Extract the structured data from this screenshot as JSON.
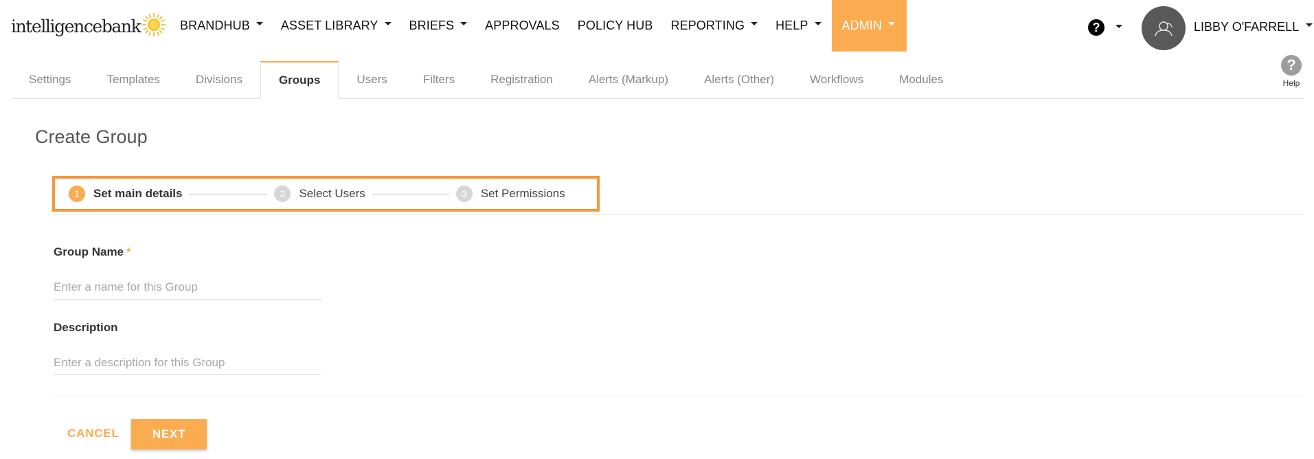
{
  "brand": {
    "logo_text": "intelligencebank",
    "accent_color": "#fbab50",
    "highlight_border_color": "#f6973a"
  },
  "topnav": {
    "items": [
      {
        "label": "BRANDHUB",
        "dropdown": true,
        "active": false
      },
      {
        "label": "ASSET LIBRARY",
        "dropdown": true,
        "active": false
      },
      {
        "label": "BRIEFS",
        "dropdown": true,
        "active": false
      },
      {
        "label": "APPROVALS",
        "dropdown": false,
        "active": false
      },
      {
        "label": "POLICY HUB",
        "dropdown": false,
        "active": false
      },
      {
        "label": "REPORTING",
        "dropdown": true,
        "active": false
      },
      {
        "label": "HELP",
        "dropdown": true,
        "active": false
      },
      {
        "label": "ADMIN",
        "dropdown": true,
        "active": true
      }
    ],
    "help_icon_glyph": "?",
    "user_name": "LIBBY O'FARRELL"
  },
  "subtabs": {
    "items": [
      {
        "label": "Settings",
        "active": false
      },
      {
        "label": "Templates",
        "active": false
      },
      {
        "label": "Divisions",
        "active": false
      },
      {
        "label": "Groups",
        "active": true
      },
      {
        "label": "Users",
        "active": false
      },
      {
        "label": "Filters",
        "active": false
      },
      {
        "label": "Registration",
        "active": false
      },
      {
        "label": "Alerts (Markup)",
        "active": false
      },
      {
        "label": "Alerts (Other)",
        "active": false
      },
      {
        "label": "Workflows",
        "active": false
      },
      {
        "label": "Modules",
        "active": false
      }
    ],
    "help_glyph": "?",
    "help_label": "Help"
  },
  "page": {
    "title": "Create Group"
  },
  "stepper": {
    "steps": [
      {
        "number": "1",
        "label": "Set main details",
        "active": true
      },
      {
        "number": "2",
        "label": "Select Users",
        "active": false
      },
      {
        "number": "3",
        "label": "Set Permissions",
        "active": false
      }
    ]
  },
  "form": {
    "group_name": {
      "label": "Group Name",
      "required_mark": "*",
      "value": "",
      "placeholder": "Enter a name for this Group"
    },
    "description": {
      "label": "Description",
      "value": "",
      "placeholder": "Enter a description for this Group"
    }
  },
  "actions": {
    "cancel_label": "CANCEL",
    "next_label": "NEXT"
  }
}
